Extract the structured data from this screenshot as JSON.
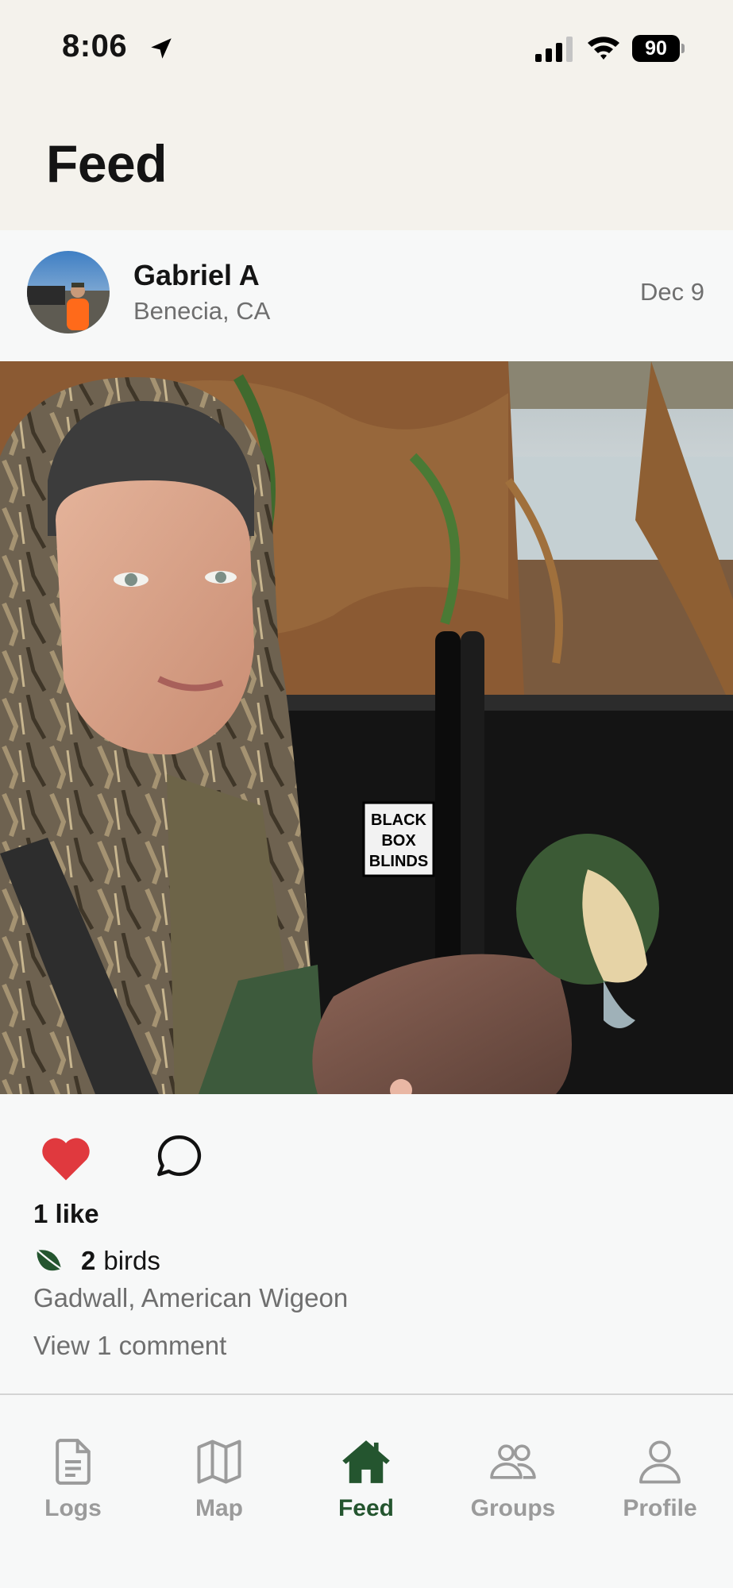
{
  "status_bar": {
    "time": "8:06",
    "battery": "90"
  },
  "header": {
    "title": "Feed"
  },
  "post": {
    "author": "Gabriel A",
    "location": "Benecia, CA",
    "date": "Dec 9",
    "photo_sign": [
      "BLACK",
      "BOX",
      "BLINDS"
    ],
    "likes_text": "1 like",
    "birds_count": "2",
    "birds_word": "birds",
    "species": "Gadwall, American Wigeon",
    "comments_link": "View 1 comment"
  },
  "tabs": [
    {
      "label": "Logs",
      "icon": "document-icon",
      "active": false
    },
    {
      "label": "Map",
      "icon": "map-icon",
      "active": false
    },
    {
      "label": "Feed",
      "icon": "home-icon",
      "active": true
    },
    {
      "label": "Groups",
      "icon": "people-icon",
      "active": false
    },
    {
      "label": "Profile",
      "icon": "person-icon",
      "active": false
    }
  ],
  "colors": {
    "brand_green": "#24552f",
    "like_red": "#e0393e",
    "header_bg": "#f4f2ec"
  }
}
